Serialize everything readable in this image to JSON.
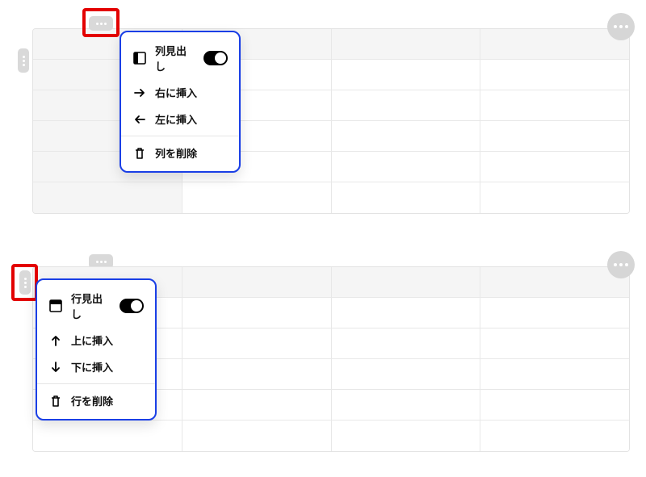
{
  "column_menu": {
    "header_label": "列見出し",
    "insert_right": "右に挿入",
    "insert_left": "左に挿入",
    "delete": "列を削除",
    "header_toggle_on": true
  },
  "row_menu": {
    "header_label": "行見出し",
    "insert_above": "上に挿入",
    "insert_below": "下に挿入",
    "delete": "行を削除",
    "header_toggle_on": true
  }
}
